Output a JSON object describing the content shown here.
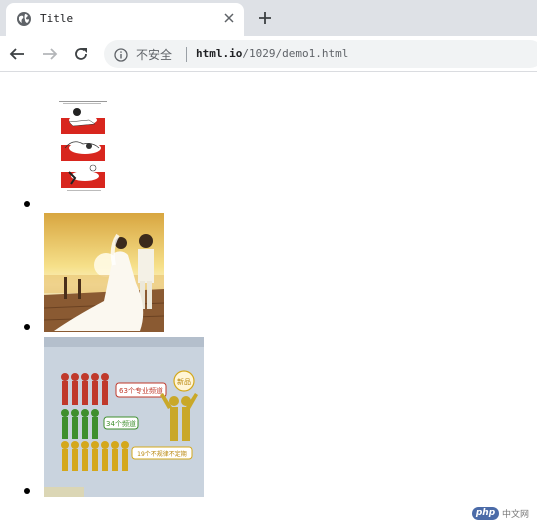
{
  "browser": {
    "tab": {
      "title": "Title"
    },
    "toolbar": {
      "security_label": "不安全",
      "url_host": "html.io",
      "url_path": "/1029/demo1.html"
    }
  },
  "page": {
    "list_items": [
      {
        "image": "cartoon-strip"
      },
      {
        "image": "wedding-photo"
      },
      {
        "image": "infographic"
      }
    ],
    "infographic": {
      "badge": "新品",
      "label_1": "63个专业频道",
      "label_2": "34个频道",
      "label_3": "19个不规律不定期"
    }
  },
  "watermark": {
    "logo": "php",
    "text": "中文网"
  },
  "colors": {
    "tabstrip": "#dee1e6",
    "omnibox": "#f1f3f4",
    "cartoon_red": "#d8261e",
    "figure_red": "#c0392b",
    "figure_green": "#3f8f2e",
    "figure_yellow": "#d4a81c"
  }
}
